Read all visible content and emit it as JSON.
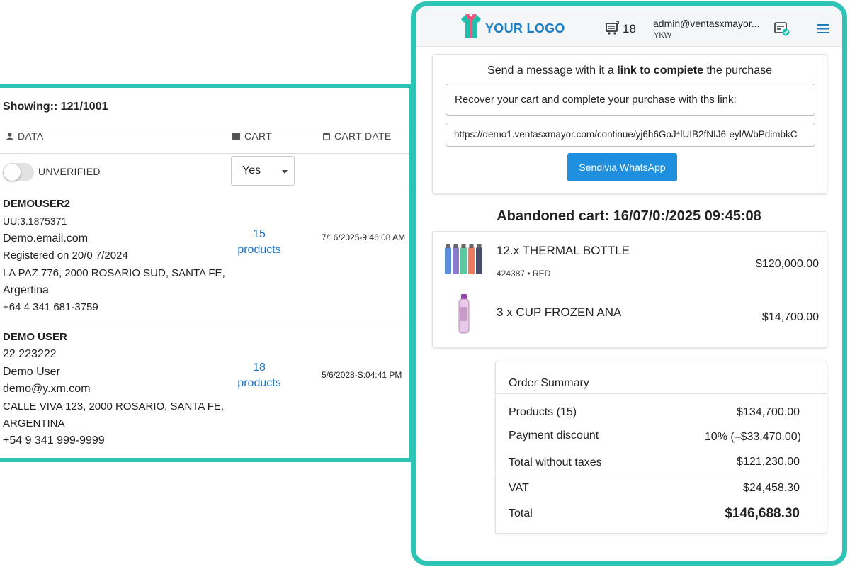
{
  "left": {
    "showing": "Showing:: 121/1001",
    "headers": {
      "data": "DATA",
      "cart": "CART",
      "cart_date": "CART DATE"
    },
    "filter": {
      "toggle_label": "UNVERIFIED",
      "select_value": "Yes"
    },
    "users": [
      {
        "name": "DEMOUSER2",
        "lines": [
          "UU:3.1875371",
          "Demo.email.com",
          "Registered on 20/0 7/2024",
          "LA PAZ 776, 2000 ROSARIO SUD, SANTA FE,",
          "Argertina",
          "+64 4 341 681-3759"
        ],
        "products_count": "15",
        "products_label": "products",
        "cart_date": "7/16/2025-9:46:08 AM"
      },
      {
        "name": "DEMO USER",
        "lines": [
          "22 223222",
          "Demo User",
          "demo@y.xm.com",
          "CALLE VIVA 123, 2000 ROSARIO, SANTA FE,",
          "ARGENTINA",
          "+54 9 341 999-9999"
        ],
        "products_count": "18",
        "products_label": "products",
        "cart_date": "5/6/2028-S:04:41 PM"
      }
    ]
  },
  "right": {
    "header": {
      "logo_text": "YOUR LOGO",
      "cart_count": "18",
      "admin_email": "admin@ventasxmayor...",
      "admin_sub": "YKW"
    },
    "message": {
      "title_pre": "Send a message with it a ",
      "title_bold": "link to compiete",
      "title_post": " the purchase",
      "text": "Recover your cart and complete your purchase with ths link:",
      "link": "https://demo1.ventasxmayor.com/continue/yj6h6GoJ⁴lUIB2fNIJ6-eyl/WbPdimbkC",
      "button": "Sendivia WhatsApp"
    },
    "abandoned_title": "Abandoned cart: 16/07/0:/2025 09:45:08",
    "items": [
      {
        "name": "12.x THERMAL BOTTLE",
        "sku": "424387 • RED",
        "price": "$120,000.00"
      },
      {
        "name": "3 x CUP FROZEN ANA",
        "sku": "",
        "price": "$14,700.00"
      }
    ],
    "summary": {
      "title": "Order Summary",
      "products_label": "Products (15)",
      "products_value": "$134,700.00",
      "discount_label": "Payment discount",
      "discount_value": "10% (–$33,470.00)",
      "wotax_label": "Total without taxes",
      "wotax_value": "$121,230.00",
      "vat_label": "VAT",
      "vat_value": "$24,458.30",
      "total_label": "Total",
      "total_value": "$146,688.30"
    }
  },
  "colors": {
    "accent": "#2cc5b5",
    "link": "#1a73c8",
    "button": "#1e90df",
    "logo": "#1c7fc4"
  }
}
